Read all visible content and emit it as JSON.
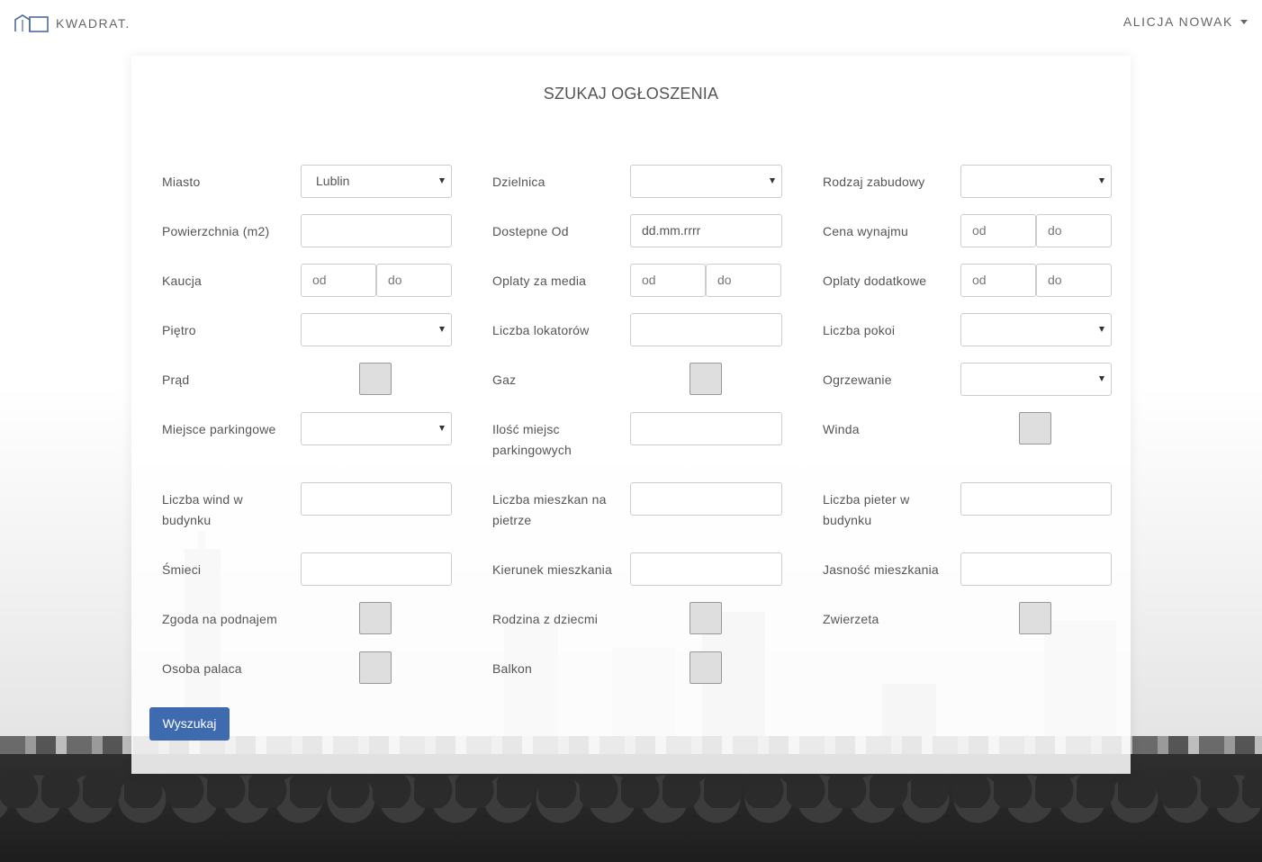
{
  "nav": {
    "brand": "KWADRAT.",
    "user": "ALICJA NOWAK"
  },
  "form": {
    "title": "SZUKAJ OGŁOSZENIA",
    "search_button": "Wyszukaj",
    "fields": {
      "miasto": {
        "label": "Miasto",
        "value": "Lublin"
      },
      "dzielnica": {
        "label": "Dzielnica",
        "value": ""
      },
      "rodzaj_zabudowy": {
        "label": "Rodzaj zabudowy",
        "value": ""
      },
      "powierzchnia": {
        "label": "Powierzchnia (m2)",
        "value": ""
      },
      "dostepne_od": {
        "label": "Dostepne Od",
        "value": "dd.mm.rrrr"
      },
      "cena_wynajmu": {
        "label": "Cena wynajmu",
        "from": "od",
        "to": "do"
      },
      "kaucja": {
        "label": "Kaucja",
        "from": "od",
        "to": "do"
      },
      "oplaty_media": {
        "label": "Oplaty za media",
        "from": "od",
        "to": "do"
      },
      "oplaty_dodatkowe": {
        "label": "Oplaty dodatkowe",
        "from": "od",
        "to": "do"
      },
      "pietro": {
        "label": "Piętro",
        "value": ""
      },
      "liczba_lokatorow": {
        "label": "Liczba lokatorów",
        "value": ""
      },
      "liczba_pokoi": {
        "label": "Liczba pokoi",
        "value": ""
      },
      "prad": {
        "label": "Prąd"
      },
      "gaz": {
        "label": "Gaz"
      },
      "ogrzewanie": {
        "label": "Ogrzewanie",
        "value": ""
      },
      "miejsce_parkingowe": {
        "label": "Miejsce parkingowe",
        "value": ""
      },
      "ilosc_miejsc": {
        "label_1": "Ilość miejsc",
        "label_2": "parkingowych",
        "value": ""
      },
      "winda": {
        "label": "Winda"
      },
      "liczba_wind": {
        "label_1": "Liczba wind w",
        "label_2": "budynku",
        "value": ""
      },
      "liczba_mieszkan": {
        "label_1": "Liczba mieszkan na",
        "label_2": "pietrze",
        "value": ""
      },
      "liczba_pieter": {
        "label_1": "Liczba pieter w",
        "label_2": "budynku",
        "value": ""
      },
      "smieci": {
        "label": "Śmieci",
        "value": ""
      },
      "kierunek": {
        "label": "Kierunek mieszkania",
        "value": ""
      },
      "jasnosc": {
        "label": "Jasność mieszkania",
        "value": ""
      },
      "zgoda_podnajem": {
        "label": "Zgoda na podnajem"
      },
      "rodzina_dzieci": {
        "label": "Rodzina z dziecmi"
      },
      "zwierzeta": {
        "label": "Zwierzeta"
      },
      "osoba_palaca": {
        "label": "Osoba palaca"
      },
      "balkon": {
        "label": "Balkon"
      }
    }
  },
  "colors": {
    "accent": "#3e6bb0",
    "text": "#555555",
    "border": "#cccccc"
  },
  "icons": {
    "brand": "house-logo-icon",
    "user_menu": "caret-down-icon",
    "select": "select-arrow-icon"
  }
}
